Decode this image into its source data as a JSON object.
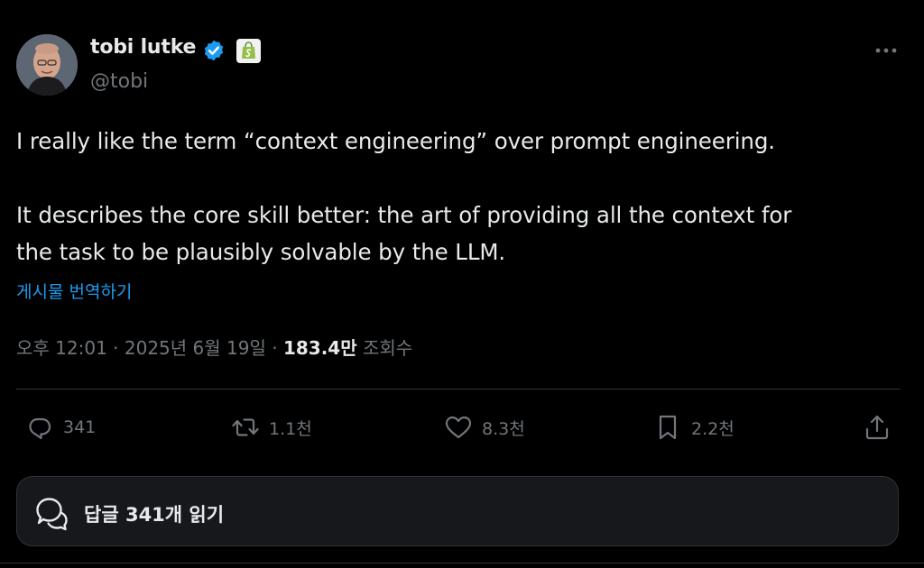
{
  "author": {
    "name": "tobi lutke",
    "handle": "@tobi",
    "verified": true,
    "affiliate": "shopify-bag-icon"
  },
  "tweet": {
    "text_line1": "I really like the term “context engineering” over prompt engineering.",
    "text_line2": "It describes the core skill better: the art of providing all the context for",
    "text_line3": "the task to be plausibly solvable by the LLM.",
    "translate_label": "게시물 번역하기"
  },
  "meta": {
    "time": "오후 12:01",
    "separator": " · ",
    "date": "2025년 6월 19일",
    "views": "183.4만",
    "views_label": "조회수"
  },
  "actions": {
    "replies": "341",
    "retweets": "1.1천",
    "likes": "8.3천",
    "bookmarks": "2.2천"
  },
  "read_replies": {
    "label": "답글 341개 읽기"
  },
  "colors": {
    "background": "#000000",
    "text": "#e7e9ea",
    "muted": "#71767b",
    "accent": "#1d9bf0",
    "verified": "#1d9bf0",
    "affiliate": "#95bf47"
  }
}
